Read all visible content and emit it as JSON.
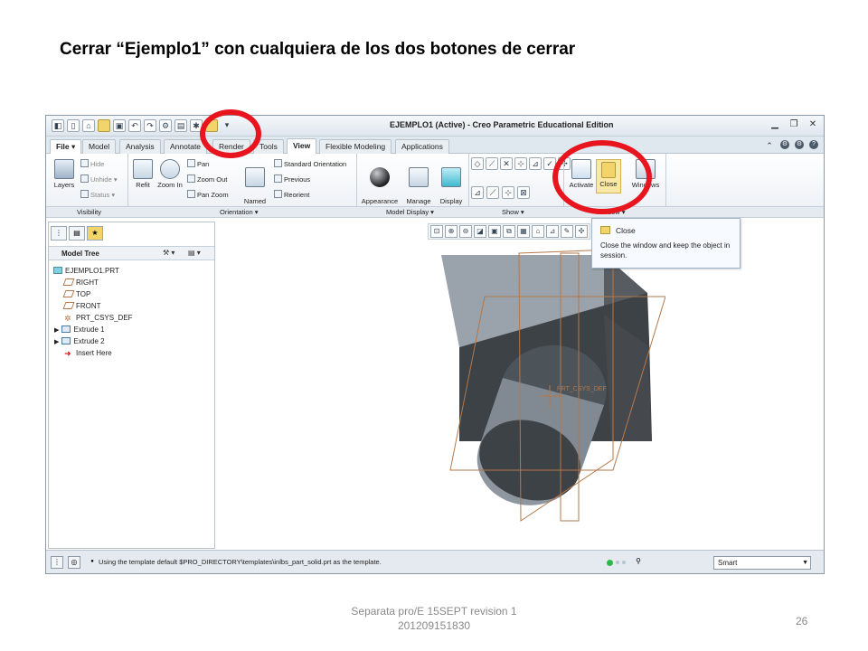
{
  "slide": {
    "title": "Cerrar “Ejemplo1” con cualquiera de los dos botones de cerrar",
    "footer_line1": "Separata pro/E 15SEPT revision 1",
    "footer_line2": "201209151830",
    "page_number": "26"
  },
  "window": {
    "title": "EJEMPLO1 (Active) - Creo Parametric Educational Edition"
  },
  "tabs": {
    "file": "File ▾",
    "model": "Model",
    "analysis": "Analysis",
    "annotate": "Annotate",
    "render": "Render",
    "tools": "Tools",
    "view": "View",
    "flexible": "Flexible Modeling",
    "applications": "Applications"
  },
  "ribbon": {
    "layers": "Layers",
    "hide": "Hide",
    "unhide": "Unhide ▾",
    "status": "Status ▾",
    "refit": "Refit",
    "zoom_in": "Zoom In",
    "pan": "Pan",
    "zoom_out": "Zoom Out",
    "pan_zoom": "Pan Zoom",
    "named_views": "Named\nViews ▾",
    "standard_orientation": "Standard Orientation",
    "previous": "Previous",
    "reorient": "Reorient",
    "appearance_gallery": "Appearance\nGallery ▾",
    "manage_views": "Manage\nViews ▾",
    "display_style": "Display\nStyle ▾",
    "activate": "Activate",
    "close": "Close",
    "windows": "Windows"
  },
  "groups": {
    "visibility": "Visibility",
    "orientation": "Orientation ▾",
    "model_display": "Model Display ▾",
    "show": "Show ▾",
    "window": "Window ▾"
  },
  "tooltip": {
    "title": "Close",
    "description": "Close the window and keep the object in session."
  },
  "model_tree": {
    "header": "Model Tree",
    "items": [
      {
        "label": "EJEMPLO1.PRT"
      },
      {
        "label": "RIGHT"
      },
      {
        "label": "TOP"
      },
      {
        "label": "FRONT"
      },
      {
        "label": "PRT_CSYS_DEF"
      },
      {
        "label": "Extrude 1"
      },
      {
        "label": "Extrude 2"
      },
      {
        "label": "Insert Here"
      }
    ]
  },
  "viewport": {
    "csys_label": "PRT_CSYS_DEF"
  },
  "statusbar": {
    "message": "Using the template default $PRO_DIRECTORY\\templates\\inlbs_part_solid.prt as the template.",
    "filter": "Smart"
  },
  "colors": {
    "highlight_ring": "#e8141e",
    "datum_plane": "#b5784a",
    "solid_dark": "#3d4247",
    "solid_light": "#9aa2ab"
  }
}
